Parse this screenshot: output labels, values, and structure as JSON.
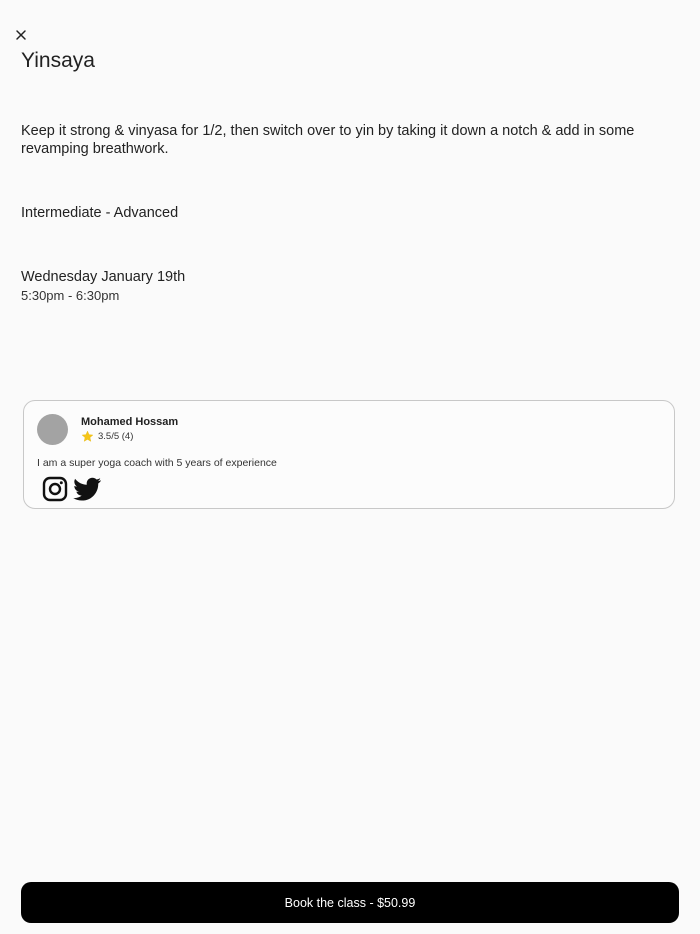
{
  "class": {
    "title": "Yinsaya",
    "description": "Keep it strong & vinyasa for 1/2, then switch over to yin by taking it down a notch & add in some revamping breathwork.",
    "level": "Intermediate - Advanced",
    "date": "Wednesday January 19th",
    "time": "5:30pm - 6:30pm"
  },
  "coach": {
    "name": "Mohamed Hossam",
    "rating": "3.5/5 (4)",
    "rating_value": 3.5,
    "rating_max": 5,
    "bio": "I am a super yoga coach with 5 years of experience",
    "social": [
      "instagram-icon",
      "twitter-icon"
    ]
  },
  "actions": {
    "book_label": "Book the class - $50.99"
  },
  "icons": {
    "close": "close-icon",
    "star": "star-icon"
  },
  "colors": {
    "background": "#fafafa",
    "button": "#000000",
    "button_text": "#ffffff",
    "star": "#f5c518",
    "avatar": "#a3a3a3",
    "card_border": "#c8c8c8"
  }
}
